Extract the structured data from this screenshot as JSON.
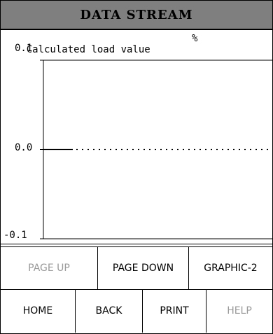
{
  "header": {
    "title": "DATA STREAM"
  },
  "parameter": {
    "name": "Calculated load value",
    "unit": "%"
  },
  "chart_data": {
    "type": "line",
    "ylim": [
      -0.1,
      0.1
    ],
    "y_ticks": [
      "0.1",
      "0.0",
      "-0.1"
    ],
    "series": [
      {
        "values": [
          0.0,
          0.0
        ]
      }
    ]
  },
  "buttons_row1": [
    "PAGE UP",
    "PAGE DOWN",
    "GRAPHIC-2"
  ],
  "buttons_row2": [
    "HOME",
    "BACK",
    "PRINT",
    "HELP"
  ],
  "disabled_buttons": [
    "PAGE UP",
    "HELP"
  ]
}
